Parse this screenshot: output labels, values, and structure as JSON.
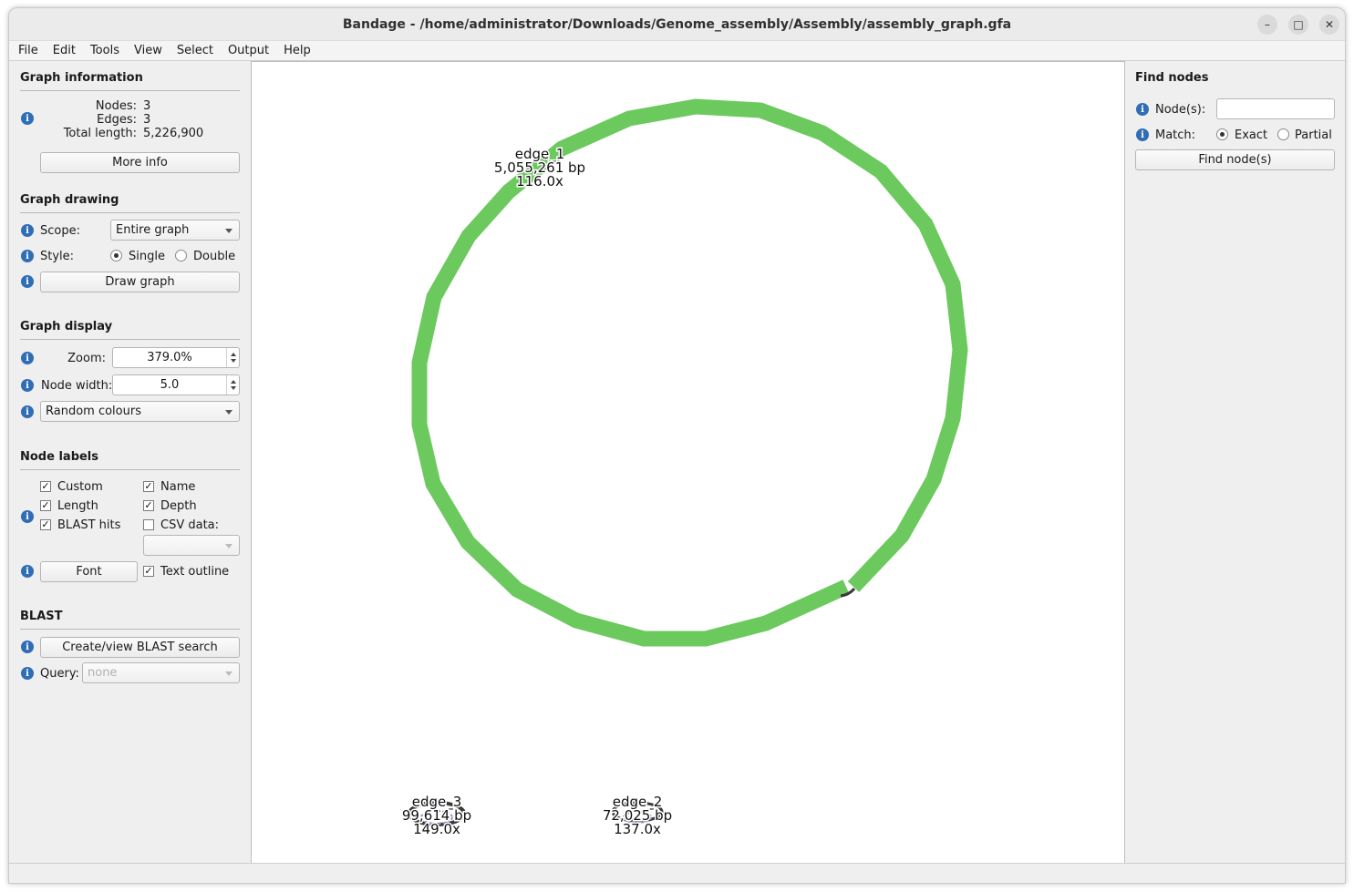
{
  "window": {
    "title": "Bandage - /home/administrator/Downloads/Genome_assembly/Assembly/assembly_graph.gfa",
    "controls": [
      "minimize-icon",
      "maximize-icon",
      "close-icon"
    ]
  },
  "menu": [
    "File",
    "Edit",
    "Tools",
    "View",
    "Select",
    "Output",
    "Help"
  ],
  "graph_information": {
    "title": "Graph information",
    "nodes_label": "Nodes:",
    "nodes_value": "3",
    "edges_label": "Edges:",
    "edges_value": "3",
    "length_label": "Total length:",
    "length_value": "5,226,900",
    "more_info": "More info"
  },
  "graph_drawing": {
    "title": "Graph drawing",
    "scope_label": "Scope:",
    "scope_value": "Entire graph",
    "style_label": "Style:",
    "style_single": "Single",
    "style_double": "Double",
    "style_selected": "Single",
    "draw_graph": "Draw graph"
  },
  "graph_display": {
    "title": "Graph display",
    "zoom_label": "Zoom:",
    "zoom_value": "379.0%",
    "node_width_label": "Node width:",
    "node_width_value": "5.0",
    "colour_scheme": "Random colours"
  },
  "node_labels": {
    "title": "Node labels",
    "custom": "Custom",
    "name": "Name",
    "length": "Length",
    "depth": "Depth",
    "blast_hits": "BLAST hits",
    "csv_data": "CSV data:",
    "checked": {
      "custom": true,
      "name": true,
      "length": true,
      "depth": true,
      "blast_hits": true,
      "csv_data": false,
      "text_outline": true
    },
    "font": "Font",
    "text_outline": "Text outline"
  },
  "blast": {
    "title": "BLAST",
    "create_search": "Create/view BLAST search",
    "query_label": "Query:",
    "query_value": "none"
  },
  "find_nodes": {
    "title": "Find nodes",
    "nodes_label": "Node(s):",
    "nodes_value": "",
    "match_label": "Match:",
    "exact": "Exact",
    "partial": "Partial",
    "match_selected": "Exact",
    "find_button": "Find node(s)"
  },
  "graph_nodes": [
    {
      "name": "edge_1",
      "length": "5,055,261 bp",
      "depth": "116.0x",
      "colour": "#6cc95e"
    },
    {
      "name": "edge_3",
      "length": "99,614 bp",
      "depth": "149.0x"
    },
    {
      "name": "edge_2",
      "length": "72,025 bp",
      "depth": "137.0x"
    }
  ],
  "colors": {
    "node_green": "#6cc95e",
    "info_icon": "#2f6db5",
    "edge_dark": "#3a3a3a"
  }
}
